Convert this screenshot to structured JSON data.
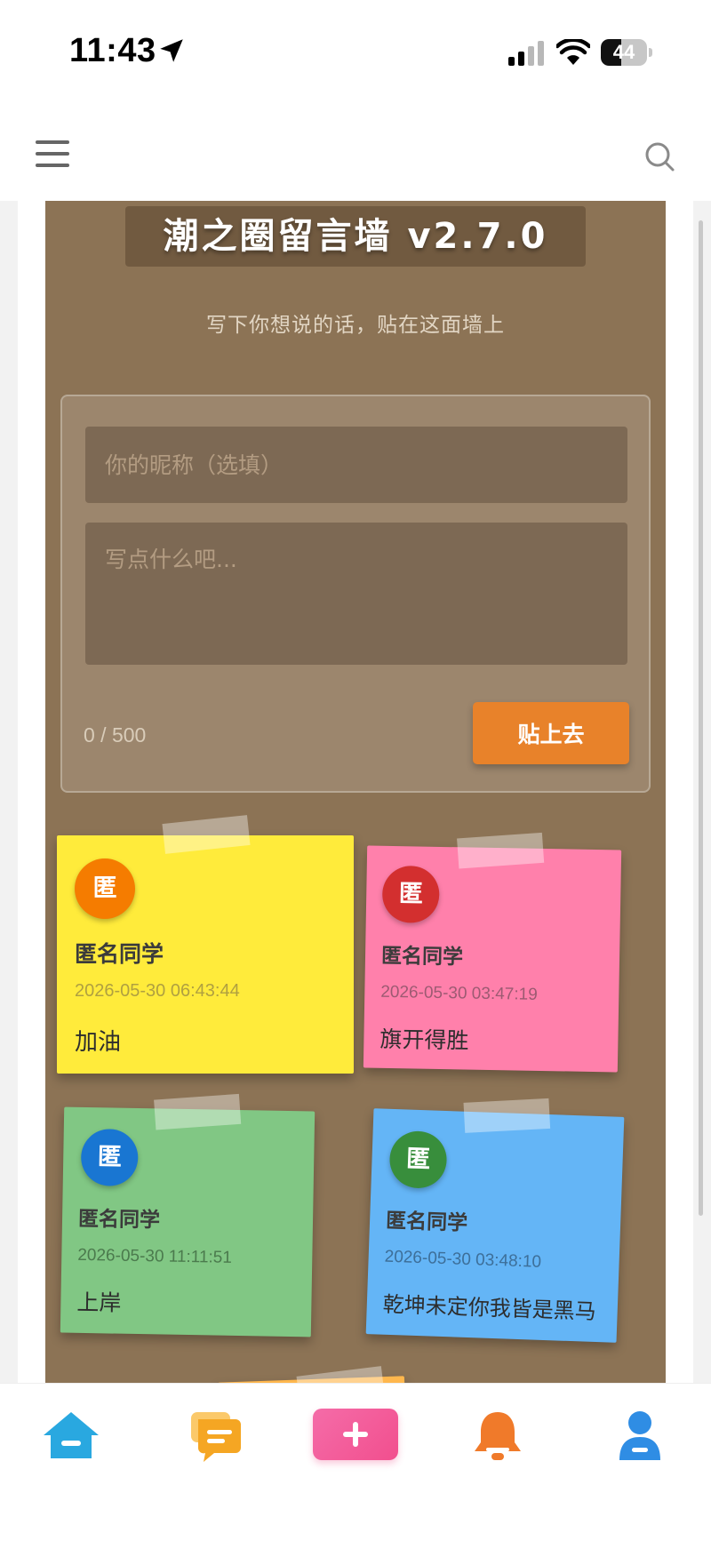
{
  "status_bar": {
    "time": "11:43",
    "battery_level": 44,
    "battery_text": "44"
  },
  "header": {
    "menu_icon": "hamburger-menu-icon",
    "search_icon": "search-icon"
  },
  "wall": {
    "title": "潮之圈留言墙 v2.7.0",
    "subtitle": "写下你想说的话，贴在这面墙上",
    "background": "#8c7355"
  },
  "form": {
    "nickname_placeholder": "你的昵称（选填）",
    "message_placeholder": "写点什么吧...",
    "counter": "0 / 500",
    "submit_label": "贴上去",
    "submit_color": "#e8822a"
  },
  "notes": [
    {
      "avatar_text": "匿",
      "avatar_color": "#f57c00",
      "author": "匿名同学",
      "timestamp": "2026-05-30 06:43:44",
      "content": "加油",
      "note_color": "#ffeb3b"
    },
    {
      "avatar_text": "匿",
      "avatar_color": "#d32f2f",
      "author": "匿名同学",
      "timestamp": "2026-05-30 03:47:19",
      "content": "旗开得胜",
      "note_color": "#ff80ab"
    },
    {
      "avatar_text": "匿",
      "avatar_color": "#1976d2",
      "author": "匿名同学",
      "timestamp": "2026-05-30 11:11:51",
      "content": "上岸",
      "note_color": "#81c784"
    },
    {
      "avatar_text": "匿",
      "avatar_color": "#388e3c",
      "author": "匿名同学",
      "timestamp": "2026-05-30 03:48:10",
      "content": "乾坤未定你我皆是黑马",
      "note_color": "#64b5f6"
    }
  ],
  "bottom_nav": {
    "items": [
      {
        "icon": "home-icon",
        "color": "#29a8e0"
      },
      {
        "icon": "message-icon",
        "color": "#f5a623"
      },
      {
        "icon": "plus-icon",
        "color": "#f24f8e"
      },
      {
        "icon": "bell-icon",
        "color": "#f07a2a"
      },
      {
        "icon": "user-icon",
        "color": "#2f8de4"
      }
    ]
  }
}
